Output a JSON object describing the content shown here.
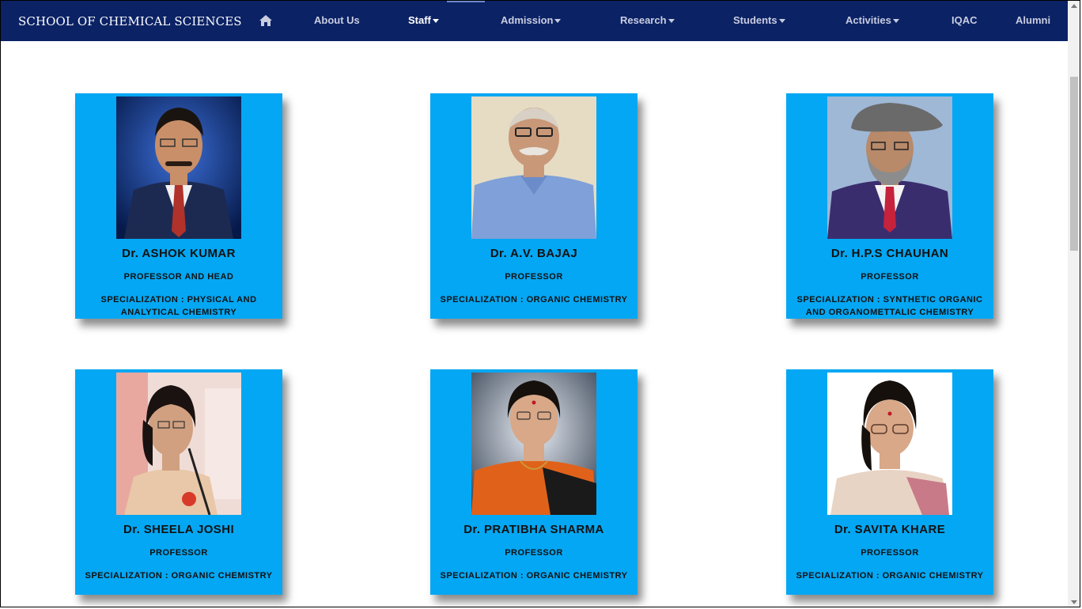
{
  "brand": "SCHOOL OF CHEMICAL SCIENCES",
  "nav": {
    "home_icon": "home-icon",
    "items": [
      {
        "label": "About Us",
        "dropdown": false
      },
      {
        "label": "Staff",
        "dropdown": true,
        "active": true
      },
      {
        "label": "Admission",
        "dropdown": true
      },
      {
        "label": "Research",
        "dropdown": true
      },
      {
        "label": "Students",
        "dropdown": true
      },
      {
        "label": "Activities",
        "dropdown": true
      },
      {
        "label": "IQAC",
        "dropdown": false
      },
      {
        "label": "Alumni",
        "dropdown": false
      }
    ]
  },
  "colors": {
    "navbar": "#0b2265",
    "card": "#04a7f3"
  },
  "faculty": [
    {
      "name": "Dr. ASHOK KUMAR",
      "role": "PROFESSOR AND HEAD",
      "specialization": "SPECIALIZATION : PHYSICAL AND ANALYTICAL CHEMISTRY"
    },
    {
      "name": "Dr. A.V. BAJAJ",
      "role": "PROFESSOR",
      "specialization": "SPECIALIZATION : ORGANIC CHEMISTRY"
    },
    {
      "name": "Dr. H.P.S CHAUHAN",
      "role": "PROFESSOR",
      "specialization": "SPECIALIZATION : SYNTHETIC ORGANIC AND ORGANOMETTALIC CHEMISTRY"
    },
    {
      "name": "Dr. SHEELA JOSHI",
      "role": "PROFESSOR",
      "specialization": "SPECIALIZATION : ORGANIC CHEMISTRY"
    },
    {
      "name": "Dr. PRATIBHA SHARMA",
      "role": "PROFESSOR",
      "specialization": "SPECIALIZATION : ORGANIC CHEMISTRY"
    },
    {
      "name": "Dr. SAVITA KHARE",
      "role": "PROFESSOR",
      "specialization": "SPECIALIZATION : ORGANIC CHEMISTRY"
    }
  ]
}
